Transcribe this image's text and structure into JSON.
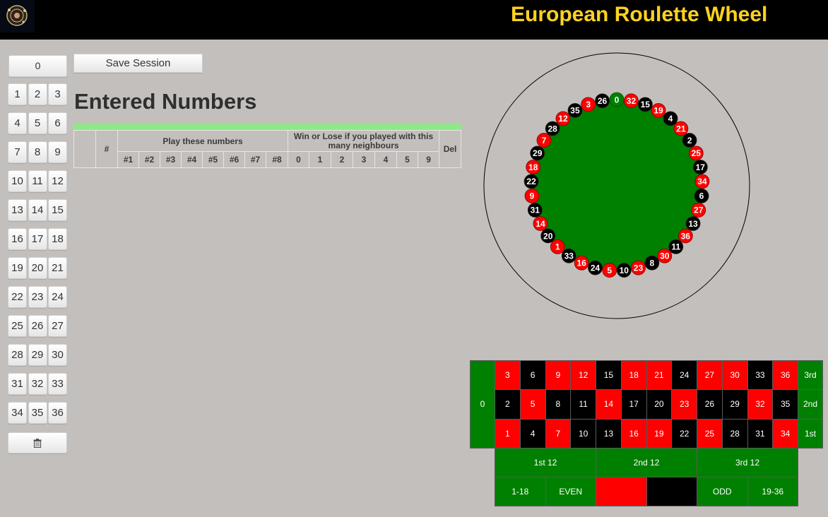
{
  "header": {
    "title": "European Roulette Wheel",
    "logo_icon": "roulette-logo-icon"
  },
  "keypad": {
    "zero": "0",
    "rows": [
      [
        "1",
        "2",
        "3"
      ],
      [
        "4",
        "5",
        "6"
      ],
      [
        "7",
        "8",
        "9"
      ],
      [
        "10",
        "11",
        "12"
      ],
      [
        "13",
        "14",
        "15"
      ],
      [
        "16",
        "17",
        "18"
      ],
      [
        "19",
        "20",
        "21"
      ],
      [
        "22",
        "23",
        "24"
      ],
      [
        "25",
        "26",
        "27"
      ],
      [
        "28",
        "29",
        "30"
      ],
      [
        "31",
        "32",
        "33"
      ],
      [
        "34",
        "35",
        "36"
      ]
    ],
    "clear_icon": "trash-icon"
  },
  "toolbar": {
    "save_label": "Save Session"
  },
  "entries": {
    "heading": "Entered Numbers",
    "header_hash": "#",
    "group_play": "Play these numbers",
    "group_win": "Win or Lose if you played with this many neighbours",
    "header_del": "Del",
    "play_columns": [
      "#1",
      "#2",
      "#3",
      "#4",
      "#5",
      "#6",
      "#7",
      "#8"
    ],
    "neighbour_columns": [
      "0",
      "1",
      "2",
      "3",
      "4",
      "5",
      "9"
    ],
    "rows": []
  },
  "wheel": {
    "order": [
      "0",
      "32",
      "15",
      "19",
      "4",
      "21",
      "2",
      "25",
      "17",
      "34",
      "6",
      "27",
      "13",
      "36",
      "11",
      "30",
      "8",
      "23",
      "10",
      "5",
      "24",
      "16",
      "33",
      "1",
      "20",
      "14",
      "31",
      "9",
      "22",
      "18",
      "29",
      "7",
      "28",
      "12",
      "35",
      "3",
      "26"
    ],
    "colors": {
      "red": "#ff0000",
      "black": "#000000",
      "green": "#008000"
    },
    "red_numbers": [
      1,
      3,
      5,
      7,
      9,
      12,
      14,
      16,
      18,
      19,
      21,
      23,
      25,
      27,
      30,
      32,
      34,
      36
    ]
  },
  "board": {
    "zero": "0",
    "rows": [
      [
        "3",
        "6",
        "9",
        "12",
        "15",
        "18",
        "21",
        "24",
        "27",
        "30",
        "33",
        "36"
      ],
      [
        "2",
        "5",
        "8",
        "11",
        "14",
        "17",
        "20",
        "23",
        "26",
        "29",
        "32",
        "35"
      ],
      [
        "1",
        "4",
        "7",
        "10",
        "13",
        "16",
        "19",
        "22",
        "25",
        "28",
        "31",
        "34"
      ]
    ],
    "columns": [
      "3rd",
      "2nd",
      "1st"
    ],
    "dozens": [
      "1st 12",
      "2nd 12",
      "3rd 12"
    ],
    "outside": [
      {
        "label": "1-18",
        "color": "green"
      },
      {
        "label": "EVEN",
        "color": "green"
      },
      {
        "label": "",
        "color": "red"
      },
      {
        "label": "",
        "color": "black"
      },
      {
        "label": "ODD",
        "color": "green"
      },
      {
        "label": "19-36",
        "color": "green"
      }
    ]
  }
}
